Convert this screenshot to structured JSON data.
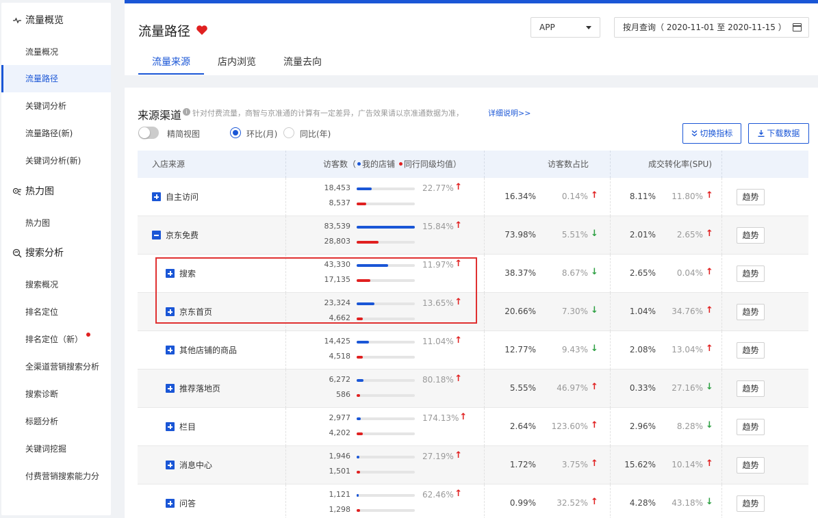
{
  "sidebar": {
    "groups": [
      {
        "label": "流量概览",
        "icon": "pulse-icon",
        "items": [
          {
            "label": "流量概况",
            "active": false
          },
          {
            "label": "流量路径",
            "active": true
          },
          {
            "label": "关键词分析",
            "active": false
          },
          {
            "label": "流量路径(新)",
            "active": false
          },
          {
            "label": "关键词分析(新)",
            "active": false
          }
        ]
      },
      {
        "label": "热力图",
        "icon": "heatmap-icon",
        "items": [
          {
            "label": "热力图",
            "active": false
          }
        ]
      },
      {
        "label": "搜索分析",
        "icon": "search-analysis-icon",
        "items": [
          {
            "label": "搜索概况",
            "active": false
          },
          {
            "label": "排名定位",
            "active": false
          },
          {
            "label": "排名定位（新）",
            "active": false,
            "new_badge": true
          },
          {
            "label": "全渠道营销搜索分析",
            "active": false
          },
          {
            "label": "搜索诊断",
            "active": false
          },
          {
            "label": "标题分析",
            "active": false
          },
          {
            "label": "关键词挖掘",
            "active": false
          },
          {
            "label": "付费营销搜索能力分",
            "active": false
          }
        ]
      }
    ]
  },
  "header": {
    "title": "流量路径",
    "platform_select": "APP",
    "date_range": "按月查询（ 2020-11-01 至 2020-11-15 ）",
    "tabs": [
      {
        "label": "流量来源",
        "active": true
      },
      {
        "label": "店内浏览",
        "active": false
      },
      {
        "label": "流量去向",
        "active": false
      }
    ]
  },
  "section": {
    "title": "来源渠道",
    "note": "针对付费流量，商智与京准通的计算有一定差异，广告效果请以京准通数据为准，",
    "link": "详细说明>>",
    "simple_view_label": "精简视图",
    "radio_mom": "环比(月)",
    "radio_yoy": "同比(年)",
    "switch_metric_button": "切换指标",
    "download_button": "下载数据"
  },
  "table": {
    "headers": {
      "source": "入店来源",
      "visitors_prefix": "访客数（",
      "visitors_my_store": "我的店铺",
      "visitors_peer": "同行同级均值",
      "visitors_suffix": "）",
      "share": "访客数占比",
      "conversion": "成交转化率(SPU)"
    },
    "trend_label": "趋势",
    "colors": {
      "my_store": "#1a56d6",
      "peer": "#e02020",
      "up": "#e02020",
      "down": "#2ea043"
    },
    "rows": [
      {
        "name": "自主访问",
        "level": 0,
        "expanded": false,
        "my_visitors": "18,453",
        "peer_visitors": "8,537",
        "my_bar": 0.26,
        "peer_bar": 0.16,
        "visitor_change": "22.77%",
        "visitor_dir": "up",
        "share": "16.34%",
        "share_change": "0.14%",
        "share_dir": "up",
        "conv": "8.11%",
        "conv_change": "11.80%",
        "conv_dir": "up"
      },
      {
        "name": "京东免费",
        "level": 0,
        "expanded": true,
        "my_visitors": "83,539",
        "peer_visitors": "28,803",
        "my_bar": 1.0,
        "peer_bar": 0.38,
        "visitor_change": "15.84%",
        "visitor_dir": "up",
        "share": "73.98%",
        "share_change": "5.51%",
        "share_dir": "down",
        "conv": "2.01%",
        "conv_change": "2.65%",
        "conv_dir": "up"
      },
      {
        "name": "搜索",
        "level": 1,
        "expanded": false,
        "my_visitors": "43,330",
        "peer_visitors": "17,135",
        "my_bar": 0.54,
        "peer_bar": 0.24,
        "visitor_change": "11.97%",
        "visitor_dir": "up",
        "share": "38.37%",
        "share_change": "8.67%",
        "share_dir": "down",
        "conv": "2.65%",
        "conv_change": "0.04%",
        "conv_dir": "up"
      },
      {
        "name": "京东首页",
        "level": 1,
        "expanded": false,
        "my_visitors": "23,324",
        "peer_visitors": "4,662",
        "my_bar": 0.31,
        "peer_bar": 0.1,
        "visitor_change": "13.65%",
        "visitor_dir": "up",
        "share": "20.66%",
        "share_change": "7.30%",
        "share_dir": "down",
        "conv": "1.04%",
        "conv_change": "34.76%",
        "conv_dir": "up"
      },
      {
        "name": "其他店铺的商品",
        "level": 1,
        "expanded": false,
        "my_visitors": "14,425",
        "peer_visitors": "4,518",
        "my_bar": 0.21,
        "peer_bar": 0.1,
        "visitor_change": "11.04%",
        "visitor_dir": "up",
        "share": "12.77%",
        "share_change": "9.43%",
        "share_dir": "down",
        "conv": "2.08%",
        "conv_change": "13.04%",
        "conv_dir": "up"
      },
      {
        "name": "推荐落地页",
        "level": 1,
        "expanded": false,
        "my_visitors": "6,272",
        "peer_visitors": "586",
        "my_bar": 0.12,
        "peer_bar": 0.04,
        "visitor_change": "80.18%",
        "visitor_dir": "up",
        "share": "5.55%",
        "share_change": "46.97%",
        "share_dir": "up",
        "conv": "0.33%",
        "conv_change": "27.16%",
        "conv_dir": "down"
      },
      {
        "name": "栏目",
        "level": 1,
        "expanded": false,
        "my_visitors": "2,977",
        "peer_visitors": "4,202",
        "my_bar": 0.07,
        "peer_bar": 0.1,
        "visitor_change": "174.13%",
        "visitor_dir": "up",
        "share": "2.64%",
        "share_change": "123.60%",
        "share_dir": "up",
        "conv": "2.96%",
        "conv_change": "8.28%",
        "conv_dir": "down"
      },
      {
        "name": "消息中心",
        "level": 1,
        "expanded": false,
        "my_visitors": "1,946",
        "peer_visitors": "1,501",
        "my_bar": 0.05,
        "peer_bar": 0.06,
        "visitor_change": "27.19%",
        "visitor_dir": "up",
        "share": "1.72%",
        "share_change": "3.75%",
        "share_dir": "up",
        "conv": "15.62%",
        "conv_change": "10.14%",
        "conv_dir": "up"
      },
      {
        "name": "问答",
        "level": 1,
        "expanded": false,
        "my_visitors": "1,121",
        "peer_visitors": "1,298",
        "my_bar": 0.04,
        "peer_bar": 0.06,
        "visitor_change": "62.46%",
        "visitor_dir": "up",
        "share": "0.99%",
        "share_change": "32.52%",
        "share_dir": "up",
        "conv": "4.28%",
        "conv_change": "43.18%",
        "conv_dir": "down"
      }
    ]
  }
}
